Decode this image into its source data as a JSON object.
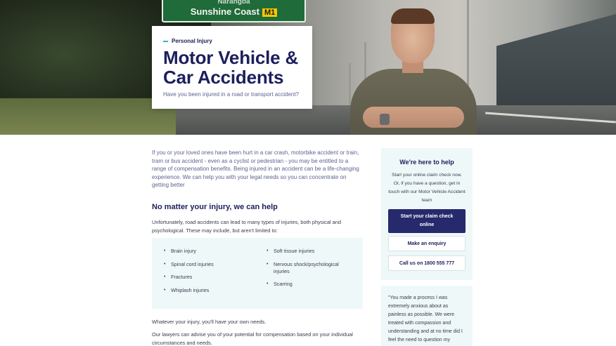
{
  "hero": {
    "sign_top": "Narangba",
    "sign_main": "Sunshine Coast",
    "sign_route": "M1",
    "eyebrow": "Personal Injury",
    "title": "Motor Vehicle & Car Accidents",
    "subtitle": "Have you been injured in a road or transport accident?"
  },
  "main": {
    "intro": "If you or your loved ones have been hurt in a car crash, motorbike accident or train, tram or bus accident - even as a cyclist or pedestrian - you may be entitled to a range of compensation benefits. Being injured in an accident can be a life-changing experience. We can help you with your legal needs so you can concentrate on getting better",
    "heading": "No matter your injury, we can help",
    "para1": "Unfortunately, road accidents can lead to many types of injuries, both physical and psychological. These may include, but aren't limited to:",
    "injuries_left": [
      "Brain injury",
      "Spinal cord injuries",
      "Fractures",
      "Whiplash injuries"
    ],
    "injuries_right": [
      "Soft tissue injuries",
      "Nervous shock/psychological injuries",
      "Scarring"
    ],
    "para2": "Whatever your injury, you'll have your own needs.",
    "para3": "Our lawyers can advise you of your potential for compensation based on your individual circumstances and needs."
  },
  "sidebar": {
    "title": "We're here to help",
    "text": "Start your online claim check now. Or, if you have a question, get in touch with our Motor Vehicle Accident team",
    "primary_button": "Start your claim check online",
    "enquiry_button": "Make an enquiry",
    "call_button": "Call us on 1800 555 777",
    "quote": "\"You made a process I was extremely anxious about as painless as possible. We were treated with compassion and understanding and at no time did I feel the need to question my"
  },
  "colors": {
    "navy": "#1c1f5c",
    "button": "#26296b",
    "accent": "#2fb5c9",
    "panel": "#eef8f9"
  }
}
